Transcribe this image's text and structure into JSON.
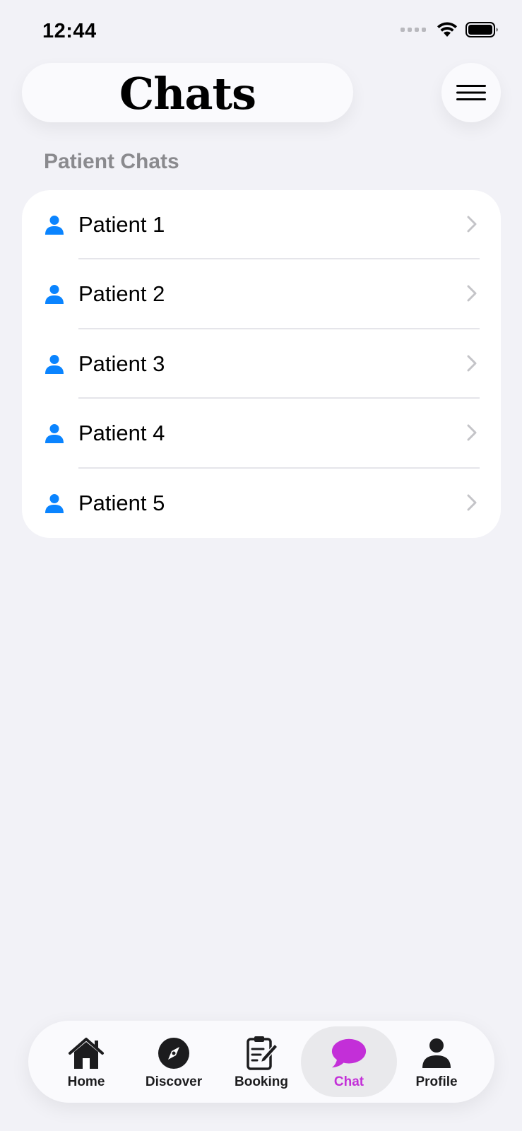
{
  "status_bar": {
    "time": "12:44"
  },
  "header": {
    "title": "Chats",
    "menu_icon": "hamburger-menu-icon"
  },
  "section": {
    "label": "Patient Chats"
  },
  "patients": [
    {
      "label": "Patient 1",
      "icon": "person-icon"
    },
    {
      "label": "Patient 2",
      "icon": "person-icon"
    },
    {
      "label": "Patient 3",
      "icon": "person-icon"
    },
    {
      "label": "Patient 4",
      "icon": "person-icon"
    },
    {
      "label": "Patient 5",
      "icon": "person-icon"
    }
  ],
  "tab_bar": {
    "tabs": [
      {
        "label": "Home",
        "icon": "house-icon",
        "active": false
      },
      {
        "label": "Discover",
        "icon": "compass-icon",
        "active": false
      },
      {
        "label": "Booking",
        "icon": "clipboard-pencil-icon",
        "active": false
      },
      {
        "label": "Chat",
        "icon": "chat-bubble-icon",
        "active": true
      },
      {
        "label": "Profile",
        "icon": "person-icon",
        "active": false
      }
    ]
  },
  "colors": {
    "background": "#f2f2f7",
    "accent_blue": "#0a84ff",
    "active_tab": "#c32fd8",
    "secondary_text": "#8a8a8e"
  }
}
